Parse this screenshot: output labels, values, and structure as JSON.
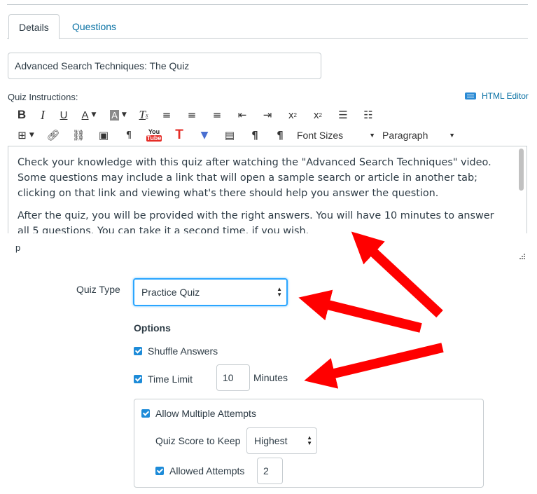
{
  "tabs": [
    {
      "label": "Details",
      "active": true
    },
    {
      "label": "Questions",
      "active": false
    }
  ],
  "quiz_title": "Advanced Search Techniques: The Quiz",
  "instructions_label": "Quiz Instructions:",
  "html_editor_link": "HTML Editor",
  "toolbar": {
    "row1_icons": [
      "bold-icon",
      "italic-icon",
      "underline-icon",
      "text-color-icon",
      "background-color-icon",
      "clear-formatting-icon",
      "align-left-icon",
      "align-center-icon",
      "align-right-icon",
      "outdent-icon",
      "indent-icon",
      "superscript-icon",
      "subscript-icon",
      "bullet-list-icon",
      "numbered-list-icon"
    ],
    "row2_icons": [
      "table-icon",
      "link-icon",
      "unlink-icon",
      "image-icon",
      "paragraph-mark-icon",
      "youtube-icon",
      "text-tool-icon",
      "equation-icon",
      "media-icon",
      "ltr-icon",
      "rtl-icon"
    ],
    "font_sizes": "Font Sizes",
    "paragraph": "Paragraph",
    "youtube_top": "You",
    "youtube_bottom": "Tube"
  },
  "editor": {
    "paragraphs": [
      "Check your knowledge with this quiz after watching the \"Advanced Search Techniques\" video. Some questions may include a link that will open a sample search or article in another tab; clicking on that link and viewing what's there should help you answer the question.",
      "After the quiz, you will be provided with the right answers. You will have 10 minutes to answer all 5 questions. You can take it a second time, if you wish."
    ],
    "path": "p"
  },
  "quiz_type": {
    "label": "Quiz Type",
    "value": "Practice Quiz"
  },
  "options": {
    "heading": "Options",
    "shuffle_answers": {
      "label": "Shuffle Answers",
      "checked": true
    },
    "time_limit": {
      "label": "Time Limit",
      "checked": true,
      "value": "10",
      "unit": "Minutes"
    },
    "multiple_attempts": {
      "label": "Allow Multiple Attempts",
      "checked": true
    },
    "score_to_keep": {
      "label": "Quiz Score to Keep",
      "value": "Highest"
    },
    "allowed_attempts": {
      "label": "Allowed Attempts",
      "checked": true,
      "value": "2"
    }
  },
  "colors": {
    "link": "#0770a3",
    "checkbox": "#1d8bd8",
    "focus_border": "#2ba6ff",
    "annotation_arrows": "#ff0000",
    "youtube_red": "#e52d27"
  }
}
